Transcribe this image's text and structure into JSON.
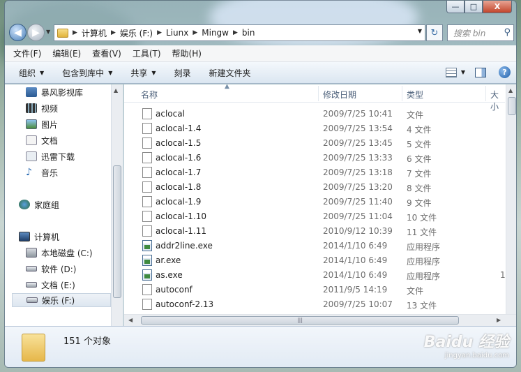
{
  "window": {
    "controls": {
      "minimize": "—",
      "maximize": "□",
      "close": "X"
    }
  },
  "address": {
    "crumbs": [
      "计算机",
      "娱乐 (F:)",
      "Liunx",
      "Mingw",
      "bin"
    ],
    "search_placeholder": "搜索 bin"
  },
  "icons": {
    "back": "back-arrow-icon",
    "forward": "forward-arrow-icon",
    "refresh": "refresh-icon",
    "search": "search-icon",
    "help": "help-icon"
  },
  "menubar": [
    "文件(F)",
    "编辑(E)",
    "查看(V)",
    "工具(T)",
    "帮助(H)"
  ],
  "toolbar": {
    "organize": "组织",
    "include_in_library": "包含到库中",
    "share": "共享",
    "burn": "刻录",
    "new_folder": "新建文件夹"
  },
  "sidebar": {
    "libraries": [
      "暴风影视库",
      "视频",
      "图片",
      "文档",
      "迅雷下载",
      "音乐"
    ],
    "homegroup": "家庭组",
    "computer": "计算机",
    "drives": [
      "本地磁盘 (C:)",
      "软件 (D:)",
      "文档 (E:)",
      "娱乐 (F:)"
    ]
  },
  "columns": {
    "name": "名称",
    "date": "修改日期",
    "type": "类型",
    "size": "大小"
  },
  "files": [
    {
      "name": "aclocal",
      "date": "2009/7/25 10:41",
      "type": "文件",
      "size": "",
      "kind": "file"
    },
    {
      "name": "aclocal-1.4",
      "date": "2009/7/25 13:54",
      "type": "4 文件",
      "size": "",
      "kind": "file"
    },
    {
      "name": "aclocal-1.5",
      "date": "2009/7/25 13:45",
      "type": "5 文件",
      "size": "",
      "kind": "file"
    },
    {
      "name": "aclocal-1.6",
      "date": "2009/7/25 13:33",
      "type": "6 文件",
      "size": "",
      "kind": "file"
    },
    {
      "name": "aclocal-1.7",
      "date": "2009/7/25 13:18",
      "type": "7 文件",
      "size": "",
      "kind": "file"
    },
    {
      "name": "aclocal-1.8",
      "date": "2009/7/25 13:20",
      "type": "8 文件",
      "size": "",
      "kind": "file"
    },
    {
      "name": "aclocal-1.9",
      "date": "2009/7/25 11:40",
      "type": "9 文件",
      "size": "",
      "kind": "file"
    },
    {
      "name": "aclocal-1.10",
      "date": "2009/7/25 11:04",
      "type": "10 文件",
      "size": "",
      "kind": "file"
    },
    {
      "name": "aclocal-1.11",
      "date": "2010/9/12 10:39",
      "type": "11 文件",
      "size": "",
      "kind": "file"
    },
    {
      "name": "addr2line.exe",
      "date": "2014/1/10 6:49",
      "type": "应用程序",
      "size": "",
      "kind": "exe"
    },
    {
      "name": "ar.exe",
      "date": "2014/1/10 6:49",
      "type": "应用程序",
      "size": "",
      "kind": "exe"
    },
    {
      "name": "as.exe",
      "date": "2014/1/10 6:49",
      "type": "应用程序",
      "size": "1,",
      "kind": "exe"
    },
    {
      "name": "autoconf",
      "date": "2011/9/5 14:19",
      "type": "文件",
      "size": "",
      "kind": "file"
    },
    {
      "name": "autoconf-2.13",
      "date": "2009/7/25 10:07",
      "type": "13 文件",
      "size": "",
      "kind": "file"
    }
  ],
  "status": {
    "count": "151 个对象"
  },
  "watermark": {
    "main": "Baidu 经验",
    "sub": "jingyan.baidu.com"
  }
}
